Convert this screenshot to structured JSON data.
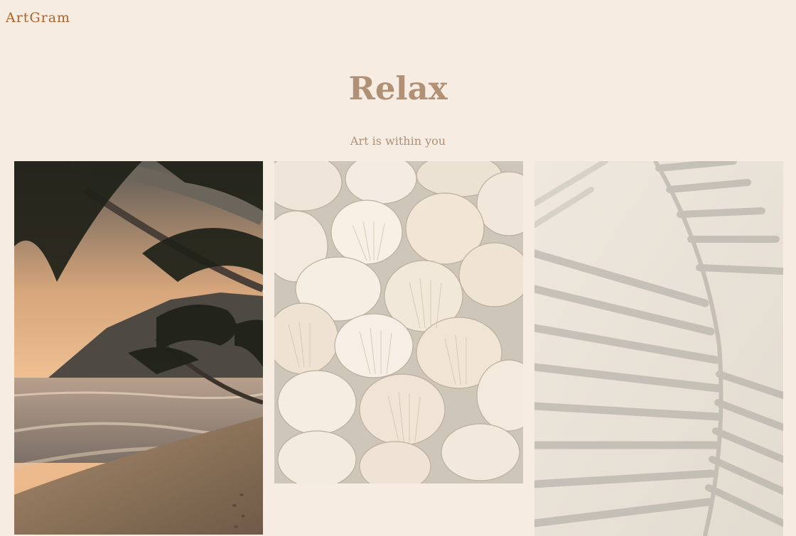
{
  "header": {
    "brand": "ArtGram"
  },
  "hero": {
    "title": "Relax",
    "subtitle": "Art is within you"
  },
  "gallery": [
    {
      "image": "beach-palms-sunset-photo"
    },
    {
      "image": "seashells-photo"
    },
    {
      "image": "palm-leaf-shadow-photo"
    }
  ],
  "colors": {
    "background": "#f6ece2",
    "brand": "#b0632a",
    "title": "#b09176",
    "subtitle": "#ad9079"
  }
}
